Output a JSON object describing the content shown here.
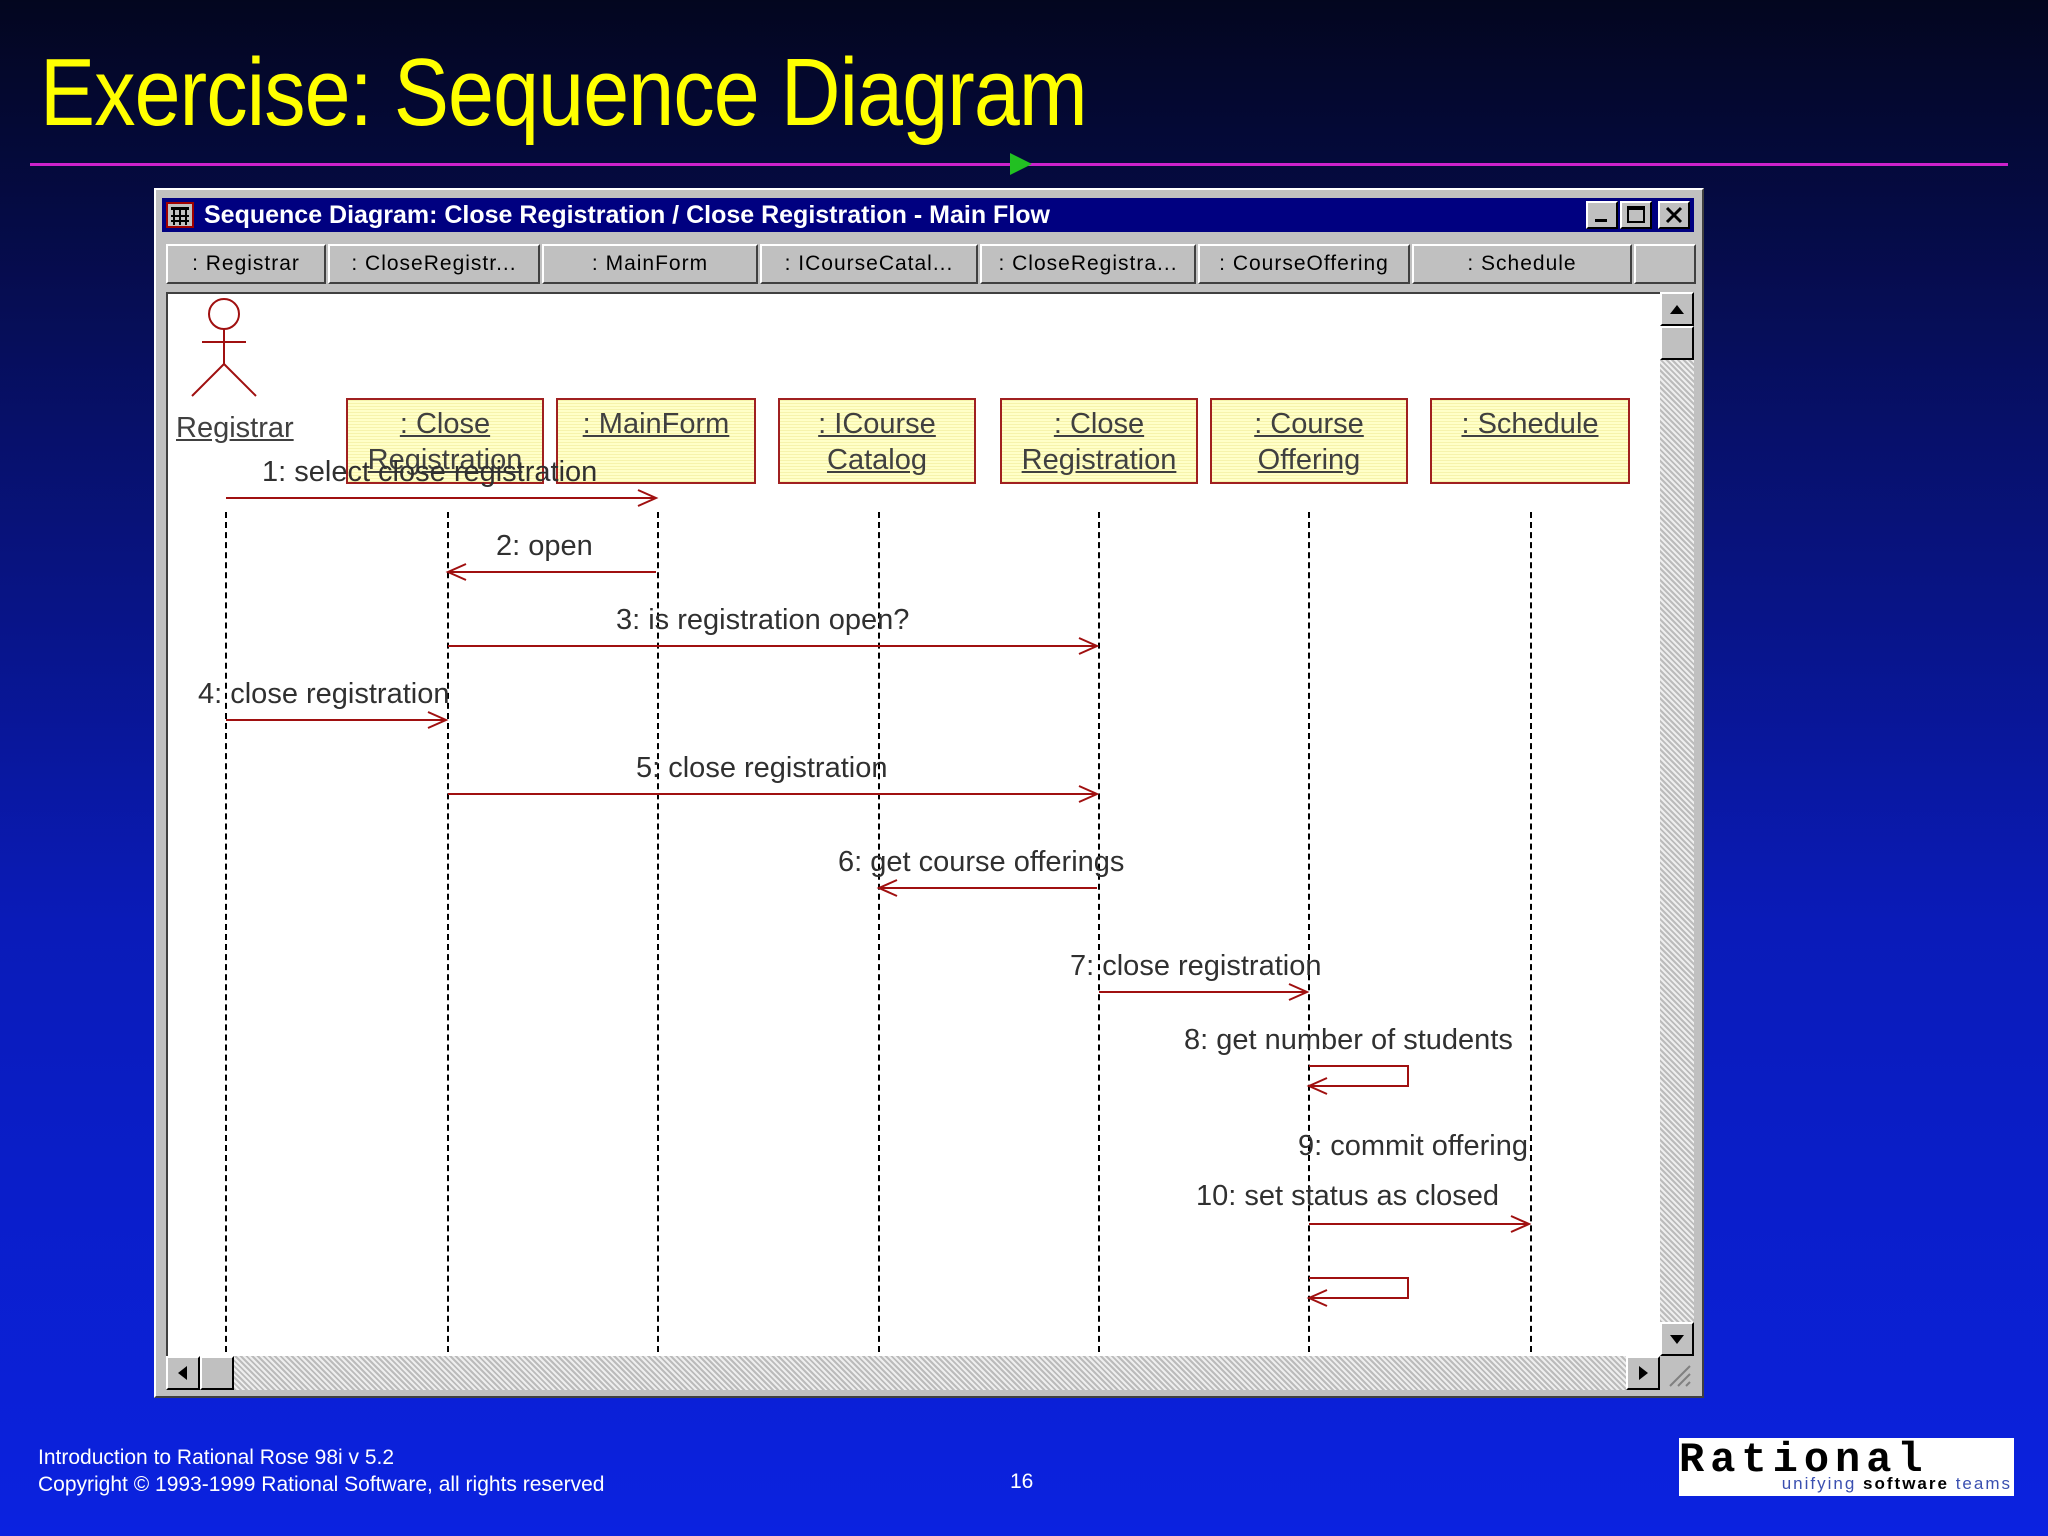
{
  "slide": {
    "title": "Exercise:  Sequence Diagram",
    "footer_line1": "Introduction to Rational Rose 98i v 5.2",
    "footer_line2": "Copyright © 1993-1999 Rational Software, all rights reserved",
    "page_number": "16",
    "logo_text": "Rational",
    "logo_tagline_1": "unifying ",
    "logo_tagline_2": "software",
    "logo_tagline_3": " teams"
  },
  "window": {
    "title": "Sequence Diagram: Close Registration / Close Registration - Main Flow",
    "tabs": [
      ": Registrar",
      ": CloseRegistr...",
      ": MainForm",
      ": ICourseCatal...",
      ": CloseRegistra...",
      ": CourseOffering",
      ": Schedule"
    ]
  },
  "diagram": {
    "actor": {
      "name": "Registrar"
    },
    "objects": [
      {
        "line1": ": Close",
        "line2": "Registration"
      },
      {
        "line1": ": MainForm",
        "line2": ""
      },
      {
        "line1": ": ICourse",
        "line2": "Catalog"
      },
      {
        "line1": ": Close",
        "line2": "Registration"
      },
      {
        "line1": ": Course",
        "line2": "Offering"
      },
      {
        "line1": ": Schedule",
        "line2": ""
      }
    ],
    "messages": [
      {
        "label": "1: select close registration",
        "from": "Registrar",
        "to": "MainForm"
      },
      {
        "label": "2: open",
        "from": "MainForm",
        "to": "Close Registration (form)"
      },
      {
        "label": "3: is registration open?",
        "from": "Close Registration (form)",
        "to": "Close Registration (control)"
      },
      {
        "label": "4: close registration",
        "from": "Registrar",
        "to": "Close Registration (form)"
      },
      {
        "label": "5: close registration",
        "from": "Close Registration (form)",
        "to": "Close Registration (control)"
      },
      {
        "label": "6: get course offerings",
        "from": "Close Registration (control)",
        "to": "ICourse Catalog"
      },
      {
        "label": "7: close registration",
        "from": "Close Registration (control)",
        "to": "Course Offering"
      },
      {
        "label": "8: get number of students",
        "from": "Course Offering",
        "to": "Course Offering"
      },
      {
        "label": "9: commit offering",
        "from": "Course Offering",
        "to": "Schedule"
      },
      {
        "label": "10: set status as closed",
        "from": "Course Offering",
        "to": "Course Offering"
      }
    ]
  },
  "colors": {
    "title": "#ffff00",
    "rule": "#cc22cc",
    "arrow": "#a01010",
    "object_fill": "#ffffc8"
  }
}
